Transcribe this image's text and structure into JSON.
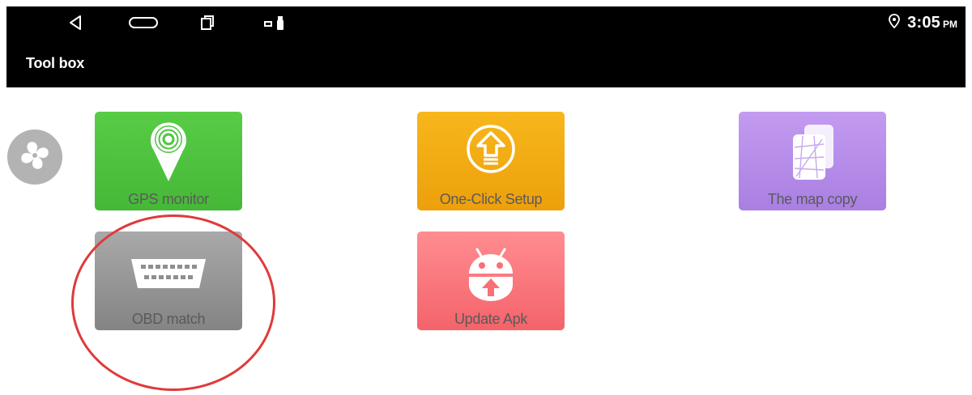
{
  "status_bar": {
    "time": "3:05",
    "ampm": "PM",
    "icons": [
      "back-icon",
      "home-icon",
      "recent-apps-icon",
      "notification-icon",
      "usb-icon",
      "location-pin-icon"
    ]
  },
  "header": {
    "title": "Tool box"
  },
  "tiles": [
    {
      "label": "GPS monitor",
      "icon": "gps-signal-pin-icon",
      "color": "#4fc43f"
    },
    {
      "label": "One-Click Setup",
      "icon": "upload-arrow-icon",
      "color": "#f2ac12"
    },
    {
      "label": "The map copy",
      "icon": "map-copy-icon",
      "color": "#b68ce9"
    },
    {
      "label": "OBD match",
      "icon": "obd-connector-icon",
      "color": "#979797"
    },
    {
      "label": "Update Apk",
      "icon": "android-update-icon",
      "color": "#fa777d"
    }
  ],
  "side_button": {
    "icon": "fan-icon",
    "color": "#b3b3b3"
  },
  "annotation": {
    "color": "#e03a3a"
  }
}
